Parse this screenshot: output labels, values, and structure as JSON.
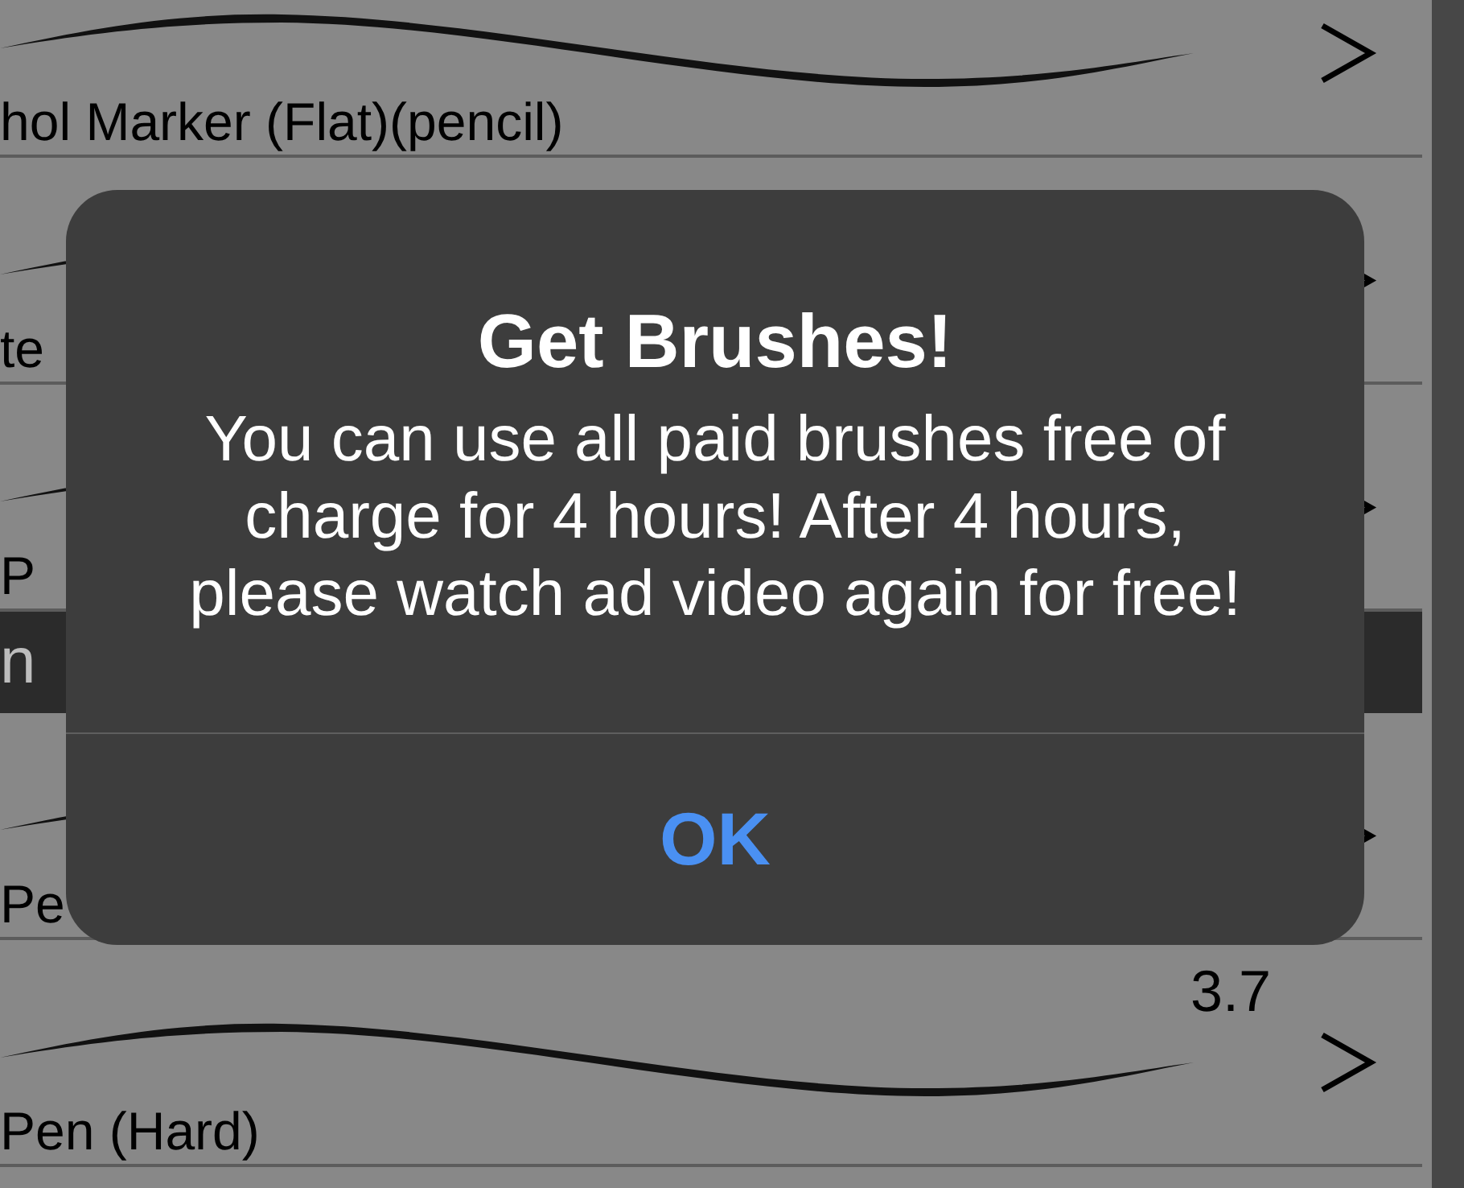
{
  "brush_list": {
    "rows": [
      {
        "kind": "brush",
        "name": "hol Marker (Flat)(pencil)"
      },
      {
        "kind": "brush",
        "name": "te"
      },
      {
        "kind": "brush",
        "name": "P"
      },
      {
        "kind": "section",
        "title": "n"
      },
      {
        "kind": "brush",
        "name": "Pe"
      },
      {
        "kind": "brush",
        "name": "Pen (Hard)",
        "value": "3.7"
      }
    ]
  },
  "alert": {
    "title": "Get Brushes!",
    "message": "You can use all paid brushes free of charge for 4 hours! After 4 hours, please watch ad video again for free!",
    "buttons": [
      "OK"
    ]
  }
}
